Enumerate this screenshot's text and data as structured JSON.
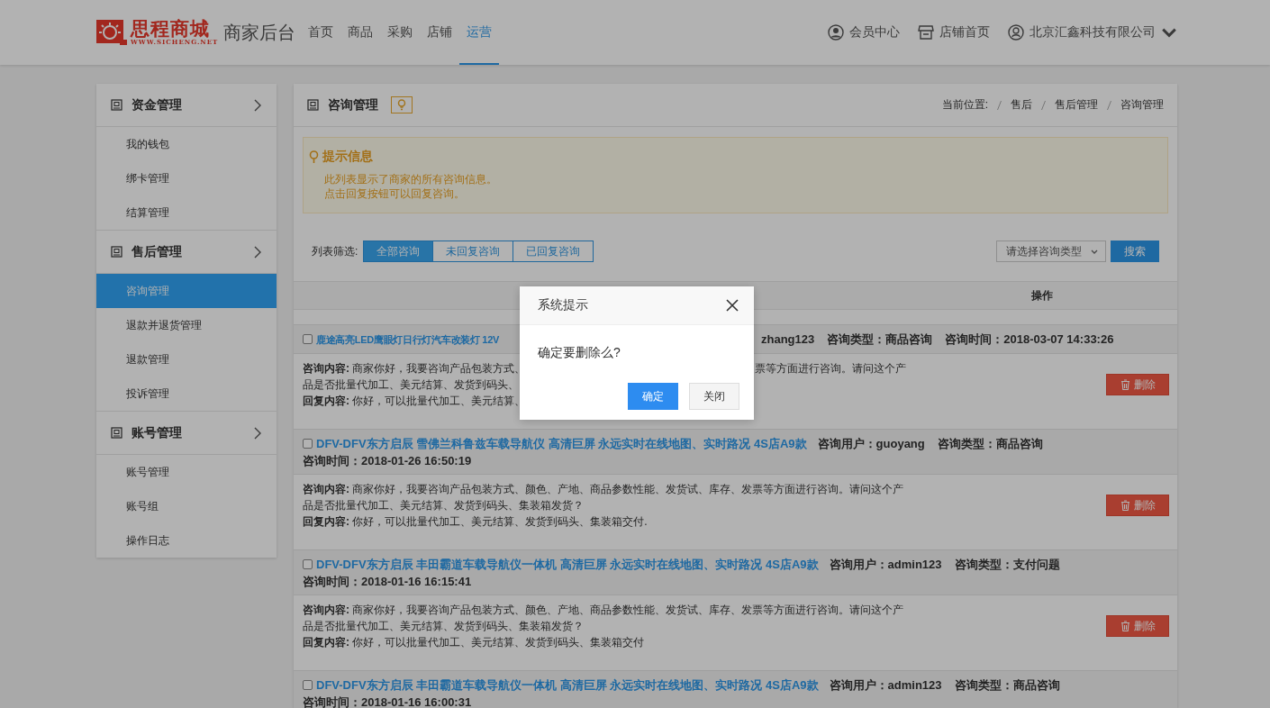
{
  "header": {
    "logo": {
      "name": "思程商城",
      "url": "WWW.SICHENG.NET"
    },
    "app_title": "商家后台",
    "nav": [
      {
        "label": "首页",
        "selected": false
      },
      {
        "label": "商品",
        "selected": false
      },
      {
        "label": "采购",
        "selected": false
      },
      {
        "label": "店铺",
        "selected": false
      },
      {
        "label": "运营",
        "selected": true
      }
    ],
    "links": [
      {
        "kind": "member",
        "label": "会员中心"
      },
      {
        "kind": "store",
        "label": "店铺首页"
      },
      {
        "kind": "account",
        "label": "北京汇鑫科技有限公司"
      }
    ]
  },
  "sidebar": {
    "groups": [
      {
        "title": "资金管理",
        "items": [
          {
            "label": "我的钱包",
            "selected": false
          },
          {
            "label": "绑卡管理",
            "selected": false
          },
          {
            "label": "结算管理",
            "selected": false
          }
        ]
      },
      {
        "title": "售后管理",
        "items": [
          {
            "label": "咨询管理",
            "selected": true
          },
          {
            "label": "退款并退货管理",
            "selected": false
          },
          {
            "label": "退款管理",
            "selected": false
          },
          {
            "label": "投诉管理",
            "selected": false
          }
        ]
      },
      {
        "title": "账号管理",
        "items": [
          {
            "label": "账号管理",
            "selected": false
          },
          {
            "label": "账号组",
            "selected": false
          },
          {
            "label": "操作日志",
            "selected": false
          }
        ]
      }
    ]
  },
  "panel": {
    "title": "咨询管理",
    "breadcrumb": [
      "当前位置:",
      "售后",
      "售后管理",
      "咨询管理"
    ],
    "notice": {
      "title": "提示信息",
      "lines": [
        "此列表显示了商家的所有咨询信息。",
        "点击回复按钮可以回复咨询。"
      ]
    },
    "filter": {
      "label": "列表筛选:",
      "options": [
        {
          "label": "全部咨询",
          "selected": true
        },
        {
          "label": "未回复咨询",
          "selected": false
        },
        {
          "label": "已回复咨询",
          "selected": false
        }
      ]
    },
    "type_select": {
      "placeholder": "请选择咨询类型"
    },
    "search_button": "搜索",
    "table": {
      "columns": [
        "操作"
      ],
      "rows": [
        {
          "kind": "covered",
          "checked": false,
          "title": "鹿途高亮LED鹰眼灯日行灯汽车改装灯 12V",
          "meta": [
            "zhang123",
            "咨询类型：商品咨询",
            "咨询时间：2018-03-07 14:33:26"
          ],
          "lines": [
            {
              "left": "**咨询内容:** 商家你好，我要咨询产品包装方式、",
              "right": "票等方面进行咨询。请问这个产"
            },
            {
              "left": "品是否批量代加工、美元结算、发货到码头、"
            },
            {
              "left": "**回复内容:** 你好，可以批量代加工、美元结算、"
            }
          ],
          "action": "删除"
        },
        {
          "kind": "full",
          "checked": false,
          "title": "DFV-DFV东方启辰 雪佛兰科鲁兹车载导航仪 高清巨屏 永远实时在线地图、实时路况 4S店A9款",
          "meta": [
            "咨询用户：guoyang",
            "咨询类型：商品咨询",
            "咨询时间：2018-01-26 16:50:19"
          ],
          "content": "**咨询内容:** 商家你好，我要咨询产品包装方式、颜色、产地、商品参数性能、发货试、库存、发票等方面进行咨询。请问这个产品是否批量代加工、美元结算、发货到码头、集装箱发货？",
          "reply": "**回复内容:** 你好，可以批量代加工、美元结算、发货到码头、集装箱交付.",
          "action": "删除"
        },
        {
          "kind": "full",
          "checked": false,
          "title": "DFV-DFV东方启辰 丰田霸道车载导航仪一体机 高清巨屏 永远实时在线地图、实时路况 4S店A9款",
          "meta": [
            "咨询用户：admin123",
            "咨询类型：支付问题",
            "咨询时间：2018-01-16 16:15:41"
          ],
          "content": "**咨询内容:** 商家你好，我要咨询产品包装方式、颜色、产地、商品参数性能、发货试、库存、发票等方面进行咨询。请问这个产品是否批量代加工、美元结算、发货到码头、集装箱发货？",
          "reply": "**回复内容:** 你好，可以批量代加工、美元结算、发货到码头、集装箱交付",
          "action": "删除"
        },
        {
          "kind": "full",
          "checked": false,
          "title": "DFV-DFV东方启辰 丰田霸道车载导航仪一体机 高清巨屏 永远实时在线地图、实时路况 4S店A9款",
          "meta": [
            "咨询用户：admin123",
            "咨询类型：商品咨询",
            "咨询时间：2018-01-16 16:00:31"
          ]
        }
      ]
    }
  },
  "dialog": {
    "title": "系统提示",
    "message": "确定要删除么?",
    "buttons": [
      {
        "kind": "primary",
        "label": "确定"
      },
      {
        "kind": "default",
        "label": "关闭"
      }
    ]
  }
}
